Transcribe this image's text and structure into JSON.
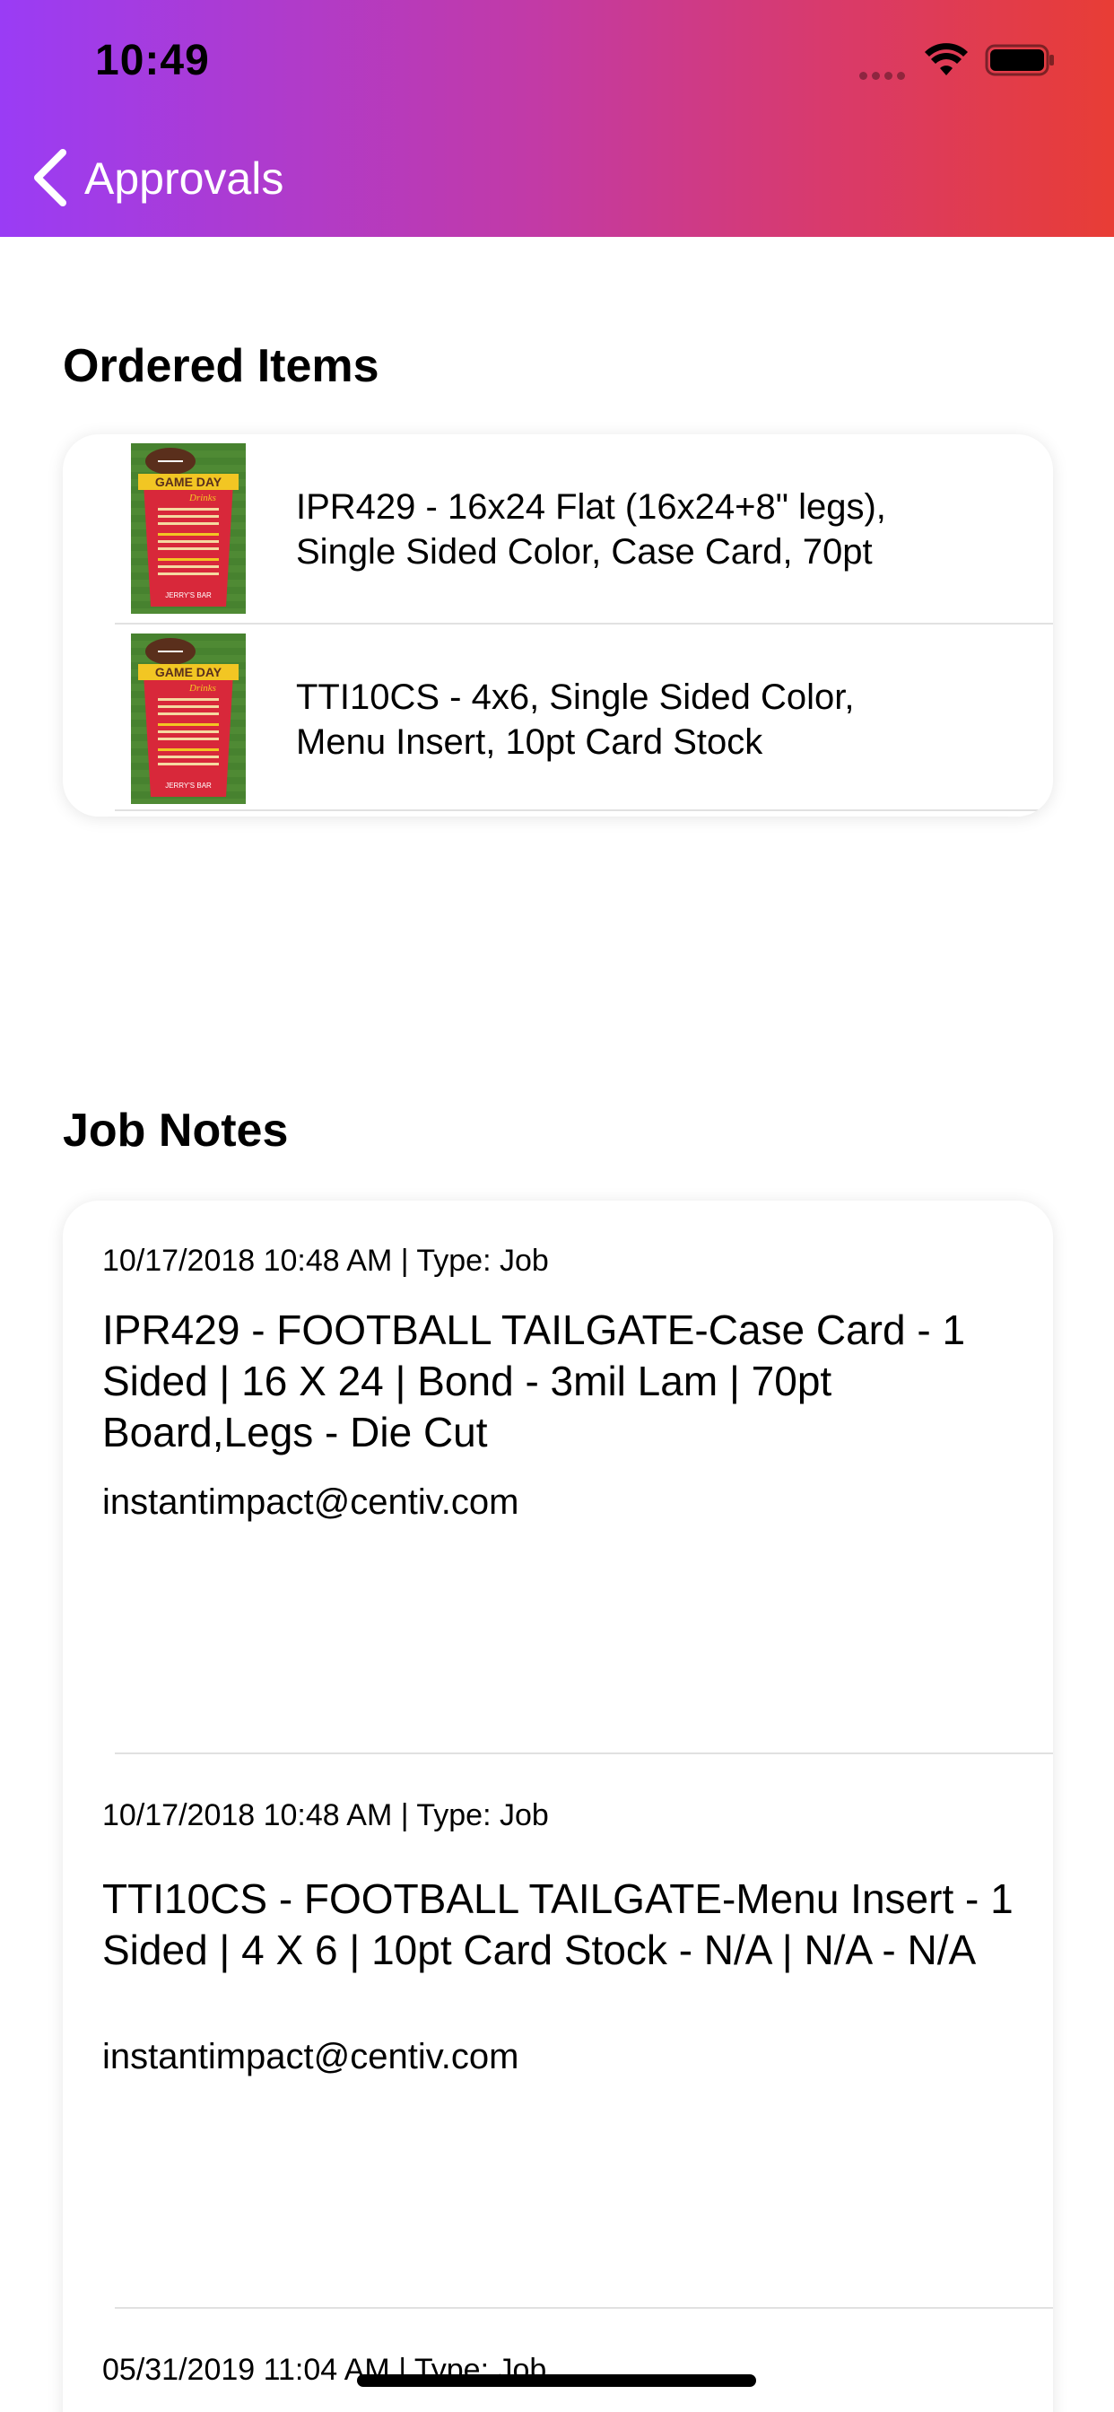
{
  "status_bar": {
    "time": "10:49"
  },
  "nav": {
    "back_label": "Approvals"
  },
  "ordered_items": {
    "title": "Ordered Items",
    "items": [
      {
        "line1": "IPR429 - 16x24 Flat (16x24+8\" legs),",
        "line2": "Single Sided Color, Case Card, 70pt",
        "thumb_text": "GAME DAY",
        "thumb_sub": "Drinks",
        "thumb_footer": "JERRY'S BAR"
      },
      {
        "line1": "TTI10CS - 4x6, Single Sided Color,",
        "line2": "Menu Insert, 10pt Card Stock",
        "thumb_text": "GAME DAY",
        "thumb_sub": "Drinks",
        "thumb_footer": "JERRY'S BAR"
      }
    ]
  },
  "job_notes": {
    "title": "Job Notes",
    "notes": [
      {
        "meta": "10/17/2018 10:48 AM | Type: Job",
        "line1": "IPR429 - FOOTBALL TAILGATE-Case Card - 1",
        "line2": "Sided | 16 X 24 | Bond - 3mil Lam | 70pt",
        "line3": "Board,Legs - Die Cut",
        "email": "instantimpact@centiv.com"
      },
      {
        "meta": "10/17/2018 10:48 AM | Type: Job",
        "line1": "TTI10CS - FOOTBALL TAILGATE-Menu Insert - 1",
        "line2": "Sided | 4 X 6 | 10pt Card Stock - N/A | N/A - N/A",
        "line3": "",
        "email": "instantimpact@centiv.com"
      },
      {
        "meta": "05/31/2019 11:04 AM | Type: Job"
      }
    ]
  },
  "colors": {
    "gradient_start": "#9a3cf5",
    "gradient_end": "#e83d35",
    "thumb_red": "#d8283a",
    "thumb_green": "#4f8a34",
    "thumb_yellow": "#f2c623"
  }
}
